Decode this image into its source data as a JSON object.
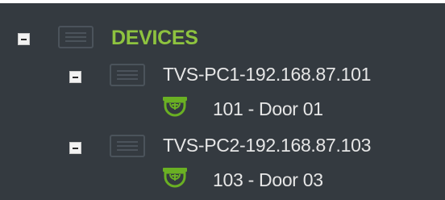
{
  "tree": {
    "root": {
      "label": "DEVICES",
      "icon": "folder-icon",
      "expanded": true,
      "accent_color": "#8ec33f"
    },
    "servers": [
      {
        "label": "TVS-PC1-192.168.87.101",
        "icon": "server-icon",
        "expanded": true,
        "doors": [
          {
            "label": "101 - Door 01",
            "icon": "door-camera-icon"
          }
        ]
      },
      {
        "label": "TVS-PC2-192.168.87.103",
        "icon": "server-icon",
        "expanded": true,
        "doors": [
          {
            "label": "103 - Door 03",
            "icon": "door-camera-icon"
          }
        ]
      }
    ]
  },
  "colors": {
    "background": "#343a40",
    "text": "#e6e6e6",
    "icon_outline": "#4b535b",
    "door_icon": "#6ab023"
  }
}
